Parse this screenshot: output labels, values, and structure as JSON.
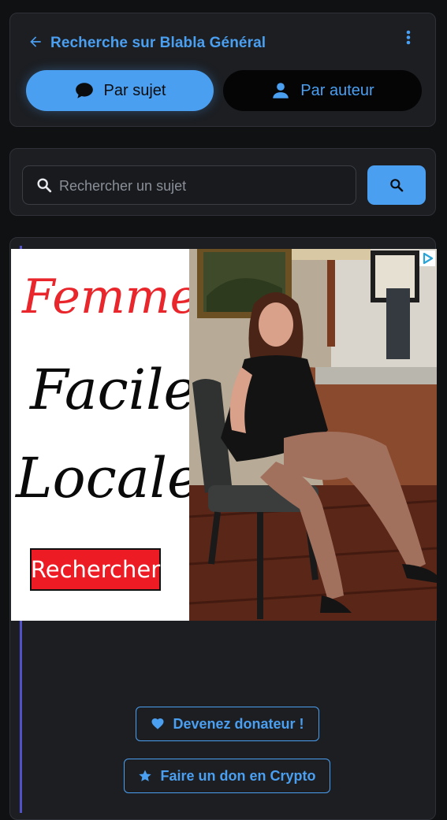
{
  "header": {
    "title": "Recherche sur Blabla Général",
    "icons": {
      "back": "arrow-left",
      "more": "vertical-dots"
    }
  },
  "tabs": [
    {
      "label": "Par sujet",
      "icon": "chat-bubble-icon",
      "active": true
    },
    {
      "label": "Par auteur",
      "icon": "person-icon",
      "active": false
    }
  ],
  "search": {
    "placeholder": "Rechercher un sujet",
    "value": "",
    "button_icon": "search-icon"
  },
  "ad": {
    "words": [
      "Femme",
      "Facile",
      "Locale"
    ],
    "cta": "Rechercher"
  },
  "donate": {
    "donor_label": "Devenez donateur !",
    "crypto_label": "Faire un don en Crypto"
  },
  "colors": {
    "accent": "#4a9ff1",
    "background": "#101113",
    "card": "#1c1e22",
    "ad_red": "#ec1b24",
    "thread_line": "#5151c9"
  }
}
